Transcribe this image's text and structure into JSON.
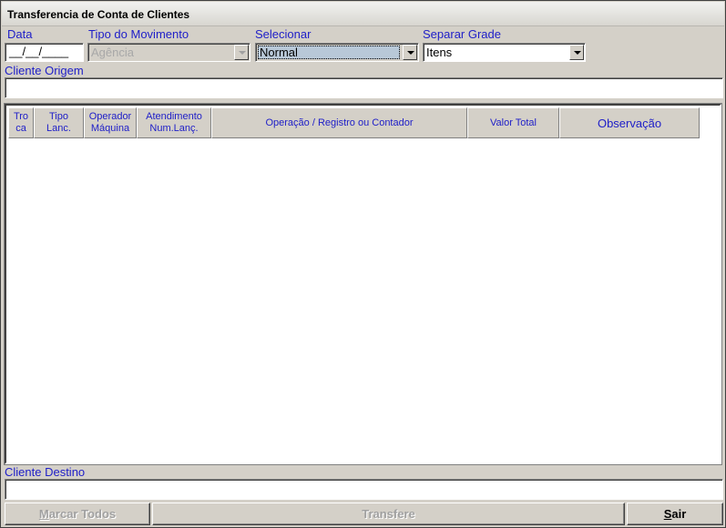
{
  "window": {
    "title": "Transferencia de Conta de Clientes"
  },
  "filters": {
    "data_label": "Data",
    "data_value": "__/__/____",
    "tipo_label": "Tipo do Movimento",
    "tipo_value": "Agência",
    "selecionar_label": "Selecionar",
    "selecionar_value": "Normal",
    "separar_label": "Separar Grade",
    "separar_value": "Itens"
  },
  "cliente_origem": {
    "label": "Cliente Origem",
    "value": ""
  },
  "grid": {
    "columns": [
      "Tro\nca",
      "Tipo\nLanc.",
      "Operador\nMáquina",
      "Atendimento\nNum.Lanç.",
      "Operação / Registro ou Contador",
      "Valor Total",
      "Observação"
    ],
    "rows": []
  },
  "cliente_destino": {
    "label": "Cliente Destino",
    "value": ""
  },
  "buttons": {
    "marcar_todos_hotkey": "M",
    "marcar_todos_rest": "arcar Todos",
    "transfere": "Transfere",
    "sair_hotkey": "S",
    "sair_rest": "air"
  }
}
